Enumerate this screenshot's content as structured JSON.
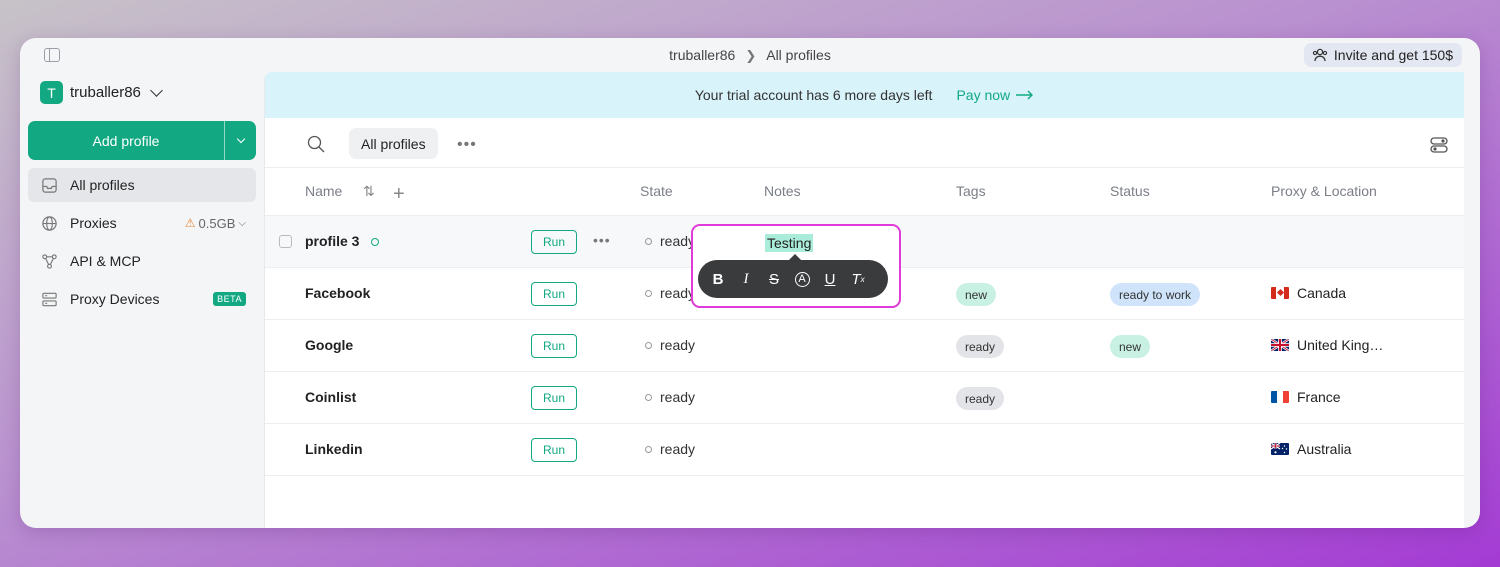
{
  "titlebar": {
    "workspace": "truballer86",
    "page": "All profiles",
    "invite_label": "Invite and get 150$"
  },
  "account": {
    "initial": "T",
    "name": "truballer86"
  },
  "add_profile_label": "Add profile",
  "sidebar": {
    "items": [
      {
        "label": "All profiles",
        "icon": "inbox-icon"
      },
      {
        "label": "Proxies",
        "icon": "globe-icon",
        "extra": "0.5GB"
      },
      {
        "label": "API & MCP",
        "icon": "api-icon"
      },
      {
        "label": "Proxy Devices",
        "icon": "devices-icon",
        "badge": "BETA"
      }
    ]
  },
  "banner": {
    "text": "Your trial account has 6 more days left",
    "action": "Pay now"
  },
  "toolbar": {
    "filter_chip": "All profiles"
  },
  "columns": [
    "Name",
    "State",
    "Notes",
    "Tags",
    "Status",
    "Proxy & Location"
  ],
  "rows": [
    {
      "name": "profile 3",
      "run": "Run",
      "state": "ready",
      "tag": "",
      "status": "",
      "location": ""
    },
    {
      "name": "Facebook",
      "run": "Run",
      "state": "ready",
      "tag": "new",
      "status": "ready to work",
      "location": "Canada"
    },
    {
      "name": "Google",
      "run": "Run",
      "state": "ready",
      "tag": "ready",
      "status": "new",
      "location": "United King…"
    },
    {
      "name": "Coinlist",
      "run": "Run",
      "state": "ready",
      "tag": "ready",
      "status": "",
      "location": "France"
    },
    {
      "name": "Linkedin",
      "run": "Run",
      "state": "ready",
      "tag": "",
      "status": "",
      "location": "Australia"
    }
  ],
  "notes_editor": {
    "text": "Testing",
    "tools": [
      "bold-icon",
      "italic-icon",
      "strikethrough-icon",
      "highlight-icon",
      "underline-icon",
      "clear-format-icon"
    ]
  },
  "colors": {
    "accent": "#12a982",
    "editor_border": "#e03ad8",
    "banner_bg": "#d8f3fa"
  }
}
